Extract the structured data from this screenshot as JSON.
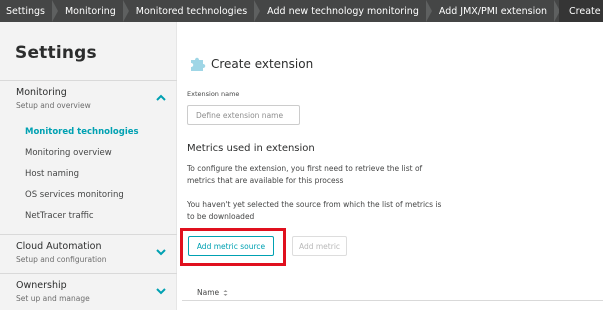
{
  "breadcrumb": [
    {
      "label": "Settings"
    },
    {
      "label": "Monitoring"
    },
    {
      "label": "Monitored technologies"
    },
    {
      "label": "Add new technology monitoring"
    },
    {
      "label": "Add JMX/PMI extension"
    },
    {
      "label": "Create extension"
    }
  ],
  "sidebar": {
    "title": "Settings",
    "sections": [
      {
        "title": "Monitoring",
        "subtitle": "Setup and overview",
        "expanded": true,
        "items": [
          {
            "label": "Monitored technologies",
            "active": true
          },
          {
            "label": "Monitoring overview"
          },
          {
            "label": "Host naming"
          },
          {
            "label": "OS services monitoring"
          },
          {
            "label": "NetTracer traffic"
          }
        ]
      },
      {
        "title": "Cloud Automation",
        "subtitle": "Setup and configuration",
        "expanded": false
      },
      {
        "title": "Ownership",
        "subtitle": "Set up and manage",
        "expanded": false
      }
    ]
  },
  "main": {
    "title": "Create extension",
    "extension_name_label": "Extension name",
    "extension_name_placeholder": "Define extension name",
    "metrics_heading": "Metrics used in extension",
    "metrics_intro": "To configure the extension, you first need to retrieve the list of metrics that are available for this process",
    "metrics_notice": "You haven't yet selected the source from which the list of metrics is to be downloaded",
    "add_metric_source_label": "Add metric source",
    "add_metric_label": "Add metric",
    "table_column_name": "Name"
  },
  "colors": {
    "accent": "#00a1b2",
    "breadcrumb_bg": "#454646",
    "highlight": "#e0101e",
    "sidebar_bg": "#f3f3f3"
  }
}
